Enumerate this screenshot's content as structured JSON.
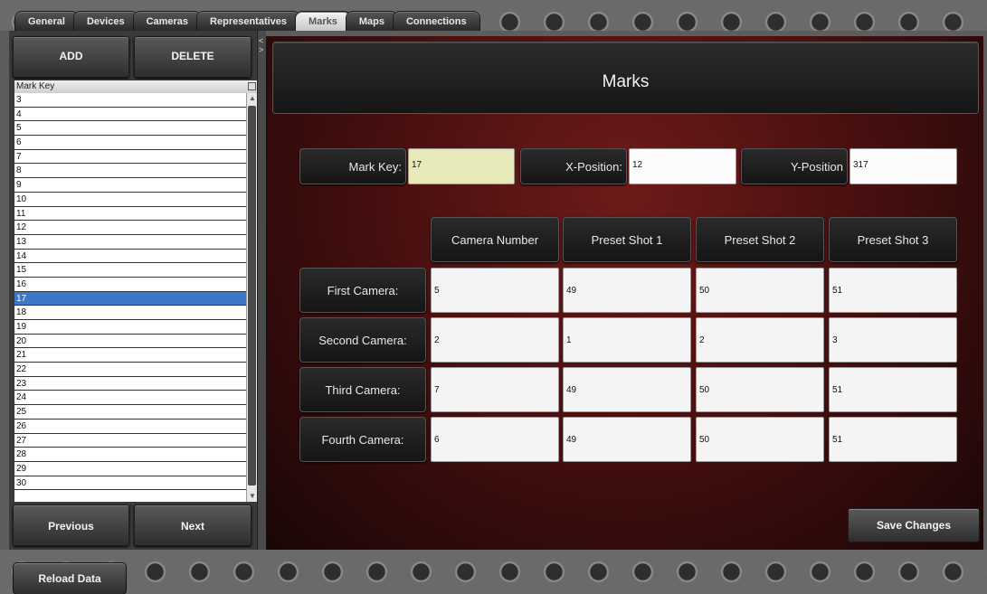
{
  "tabs": [
    {
      "label": "General",
      "active": false
    },
    {
      "label": "Devices",
      "active": false
    },
    {
      "label": "Cameras",
      "active": false
    },
    {
      "label": "Representatives",
      "active": false
    },
    {
      "label": "Marks",
      "active": true
    },
    {
      "label": "Maps",
      "active": false
    },
    {
      "label": "Connections",
      "active": false
    }
  ],
  "left": {
    "add_label": "ADD",
    "delete_label": "DELETE",
    "list_header": "Mark Key",
    "items": [
      "3",
      "4",
      "5",
      "6",
      "7",
      "8",
      "9",
      "10",
      "11",
      "12",
      "13",
      "14",
      "15",
      "16",
      "17",
      "18",
      "19",
      "20",
      "21",
      "22",
      "23",
      "24",
      "25",
      "26",
      "27",
      "28",
      "29",
      "30"
    ],
    "selected": "17",
    "previous_label": "Previous",
    "next_label": "Next"
  },
  "main": {
    "title": "Marks",
    "mark_key_label": "Mark Key:",
    "mark_key_value": "17",
    "x_label": "X-Position:",
    "x_value": "12",
    "y_label": "Y-Position",
    "y_value": "317",
    "columns": [
      "Camera Number",
      "Preset Shot 1",
      "Preset Shot 2",
      "Preset Shot 3"
    ],
    "rows": [
      {
        "label": "First Camera:",
        "values": [
          "5",
          "49",
          "50",
          "51"
        ]
      },
      {
        "label": "Second Camera:",
        "values": [
          "2",
          "1",
          "2",
          "3"
        ]
      },
      {
        "label": "Third Camera:",
        "values": [
          "7",
          "49",
          "50",
          "51"
        ]
      },
      {
        "label": "Fourth Camera:",
        "values": [
          "6",
          "49",
          "50",
          "51"
        ]
      }
    ],
    "save_label": "Save Changes"
  },
  "bottom": {
    "reload_label": "Reload Data"
  },
  "colors": {
    "accent_red": "#6e1a1a",
    "selection_blue": "#3a78c8",
    "highlight_field": "#e7e9b9"
  }
}
